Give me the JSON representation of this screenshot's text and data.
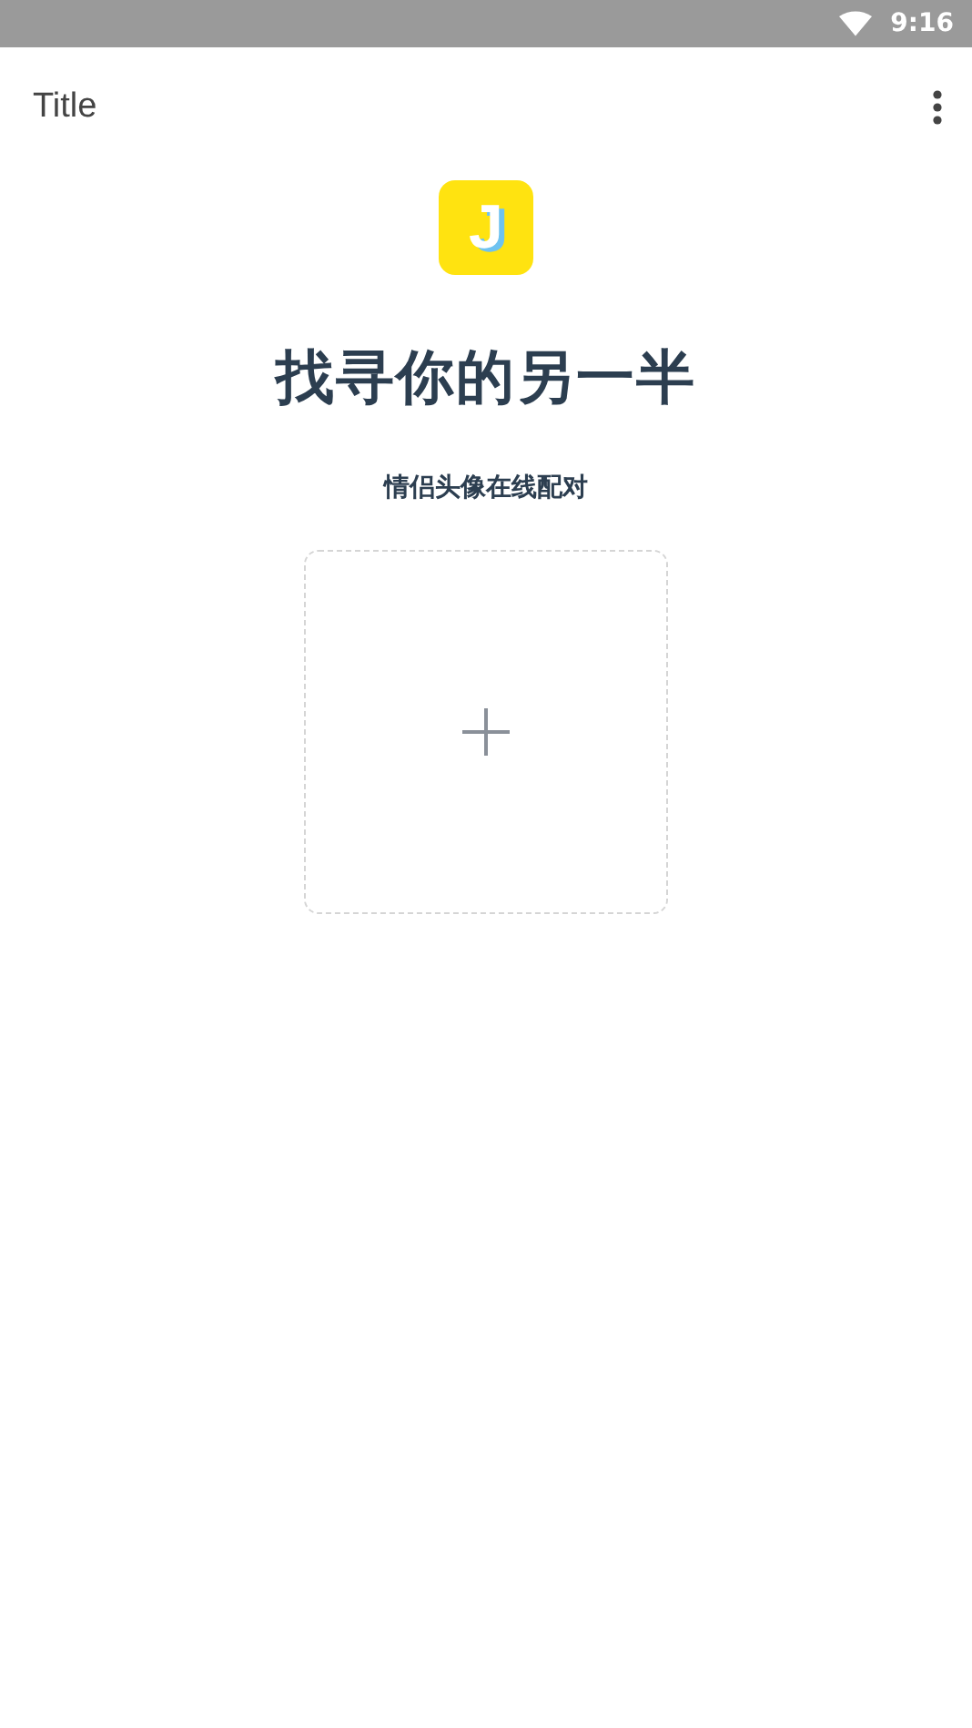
{
  "status_bar": {
    "time": "9:16"
  },
  "app_bar": {
    "title": "Title"
  },
  "logo": {
    "letter": "J"
  },
  "headline": "找寻你的另一半",
  "subtitle": "情侣头像在线配对"
}
